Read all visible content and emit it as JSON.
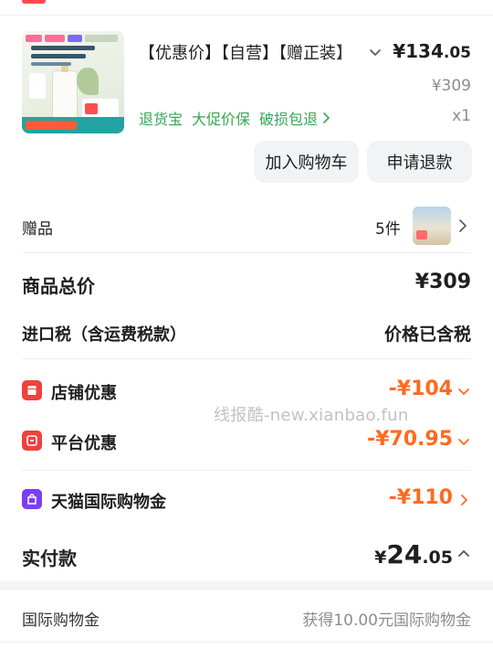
{
  "product": {
    "title": "【优惠价】【自营】【赠正装】",
    "price_main": "¥134",
    "price_decimal": ".05",
    "original_price": "¥309",
    "services": [
      "退货宝",
      "大促价保",
      "破损包退"
    ],
    "quantity": "x1"
  },
  "actions": {
    "add_to_cart": "加入购物车",
    "request_refund": "申请退款"
  },
  "gift": {
    "label": "赠品",
    "count": "5件"
  },
  "summary": {
    "total_label": "商品总价",
    "total_value": "¥309",
    "tax_label": "进口税（含运费税款）",
    "tax_value": "价格已含税"
  },
  "discounts": [
    {
      "label": "店铺优惠",
      "value": "-¥104"
    },
    {
      "label": "平台优惠",
      "value": "-¥70.95"
    },
    {
      "label": "天猫国际购物金",
      "value": "-¥110"
    }
  ],
  "payment": {
    "label": "实付款",
    "currency": "¥",
    "amount_main": "24",
    "amount_decimal": ".05"
  },
  "intl_credit": {
    "label": "国际购物金",
    "value": "获得10.00元国际购物金"
  },
  "watermark": "线报酷-new.xianbao.fun",
  "colors": {
    "discount_orange": "#ff6a1f",
    "service_green": "#34a853",
    "shop_icon_red": "#f0413b",
    "credit_icon_purple": "#7b3ff2"
  }
}
